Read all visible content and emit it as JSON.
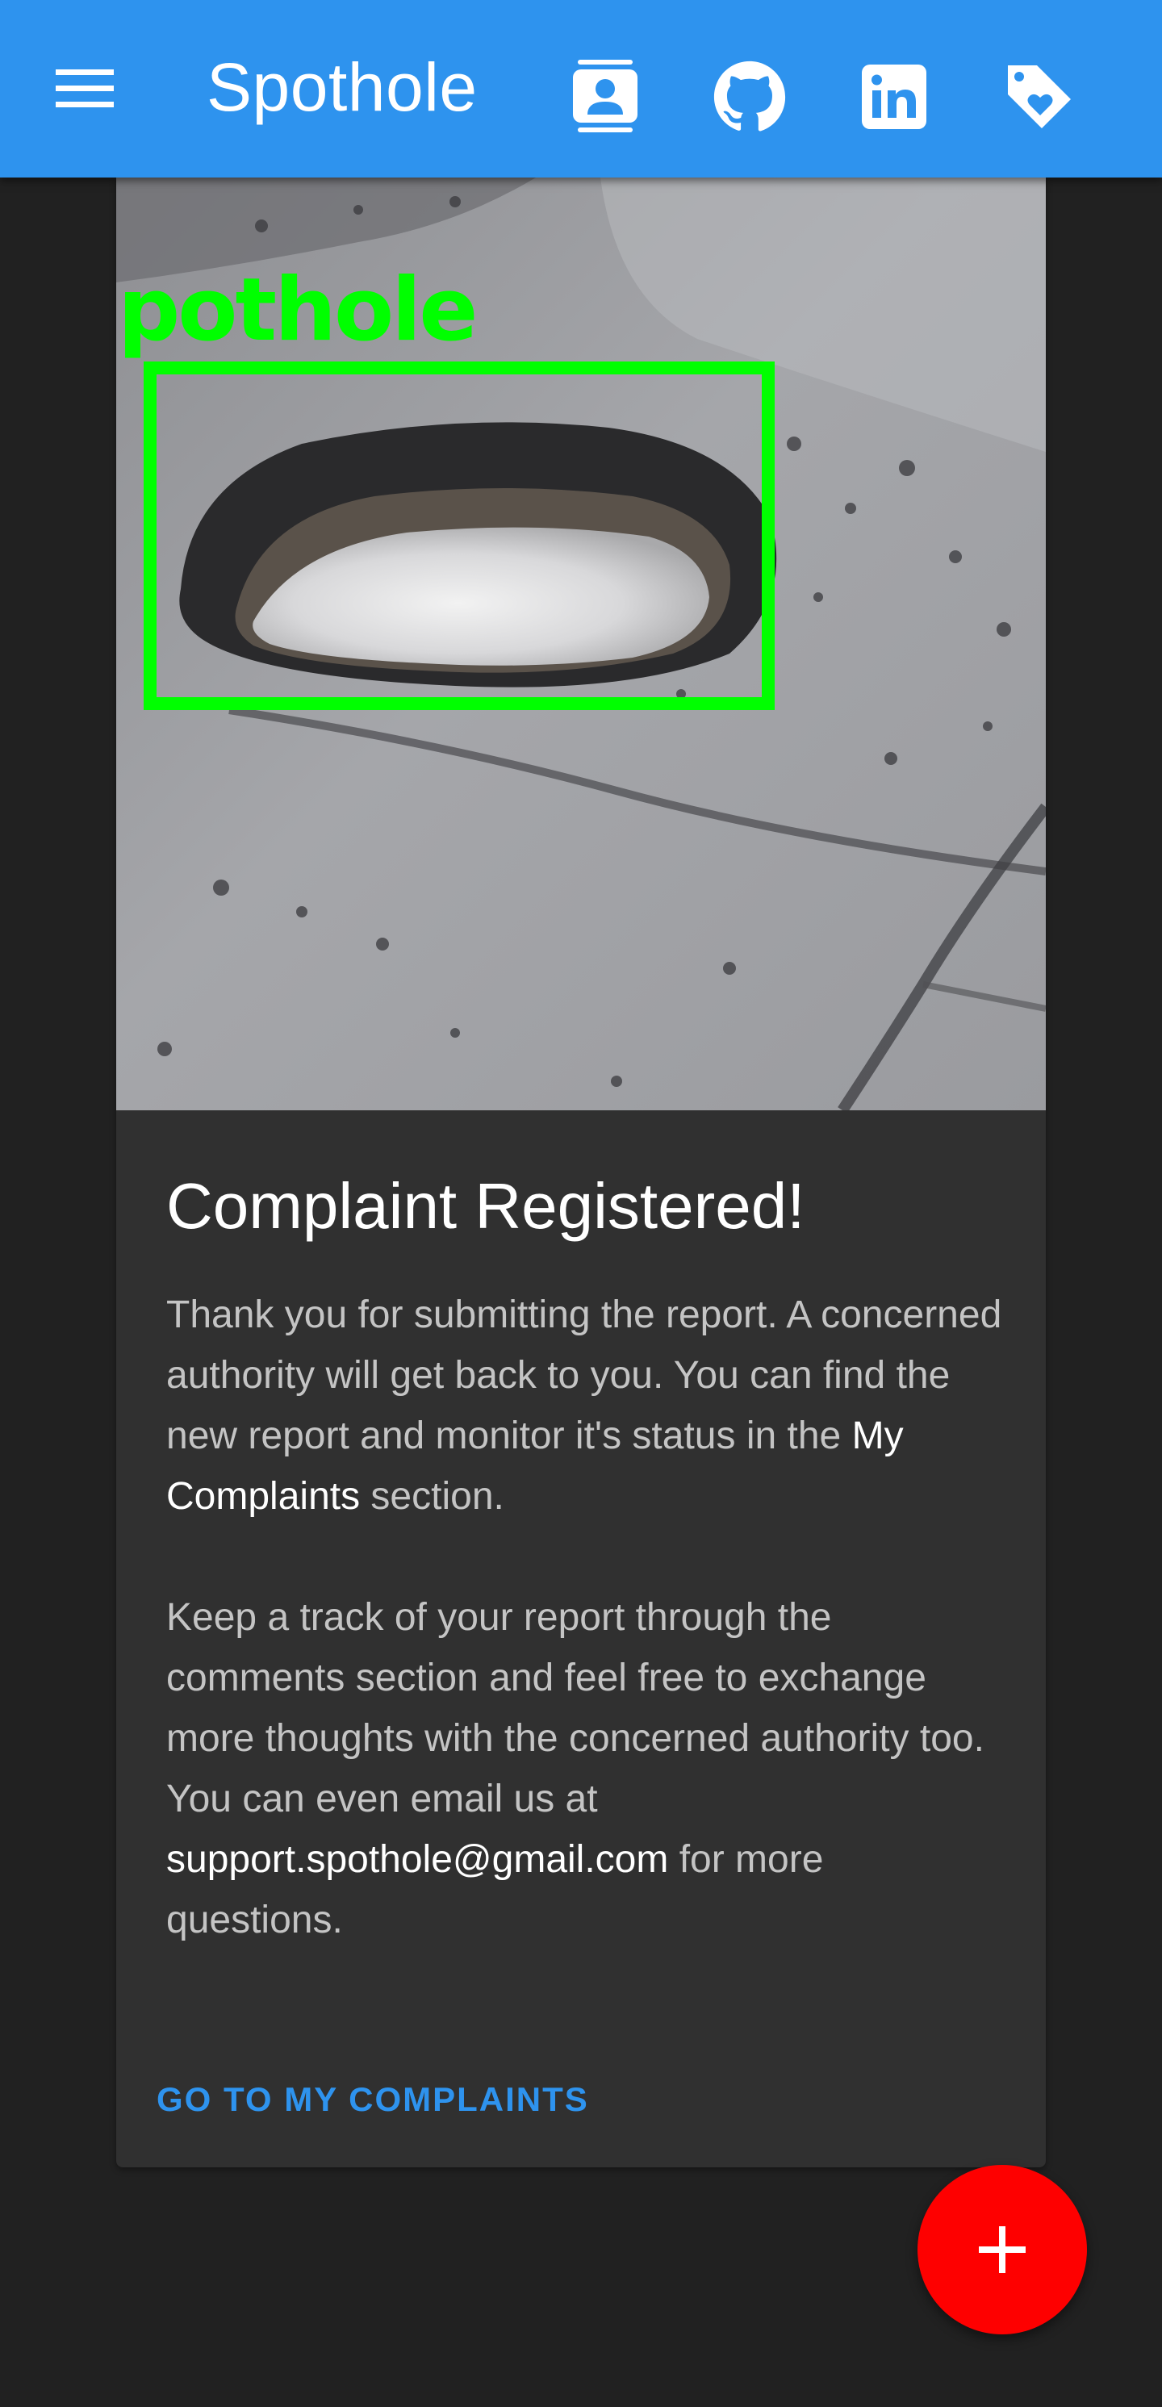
{
  "app_bar": {
    "title": "Spothole",
    "icons": [
      "menu-icon",
      "contact-card-icon",
      "github-icon",
      "linkedin-icon",
      "tag-heart-icon"
    ]
  },
  "card": {
    "image_label": "pothole",
    "title": "Complaint Registered!",
    "paragraph1": {
      "before": "Thank you for submitting the report. A concerned authority will get back to you. You can find the new report and monitor it's status in the ",
      "highlight": "My Complaints",
      "after": " section."
    },
    "paragraph2": {
      "before": "Keep a track of your report through the comments section and feel free to exchange more thoughts with the concerned authority too. You can even email us at ",
      "highlight": "support.spothole@gmail.com",
      "after": " for more questions."
    },
    "action_label": "GO TO MY COMPLAINTS"
  },
  "fab": {
    "icon": "plus-icon"
  },
  "colors": {
    "app_bar": "#2e93ee",
    "background": "#212121",
    "card": "#303030",
    "fab": "#fe0000",
    "detection_box": "#00ff00",
    "accent_text": "#2e93ee"
  }
}
